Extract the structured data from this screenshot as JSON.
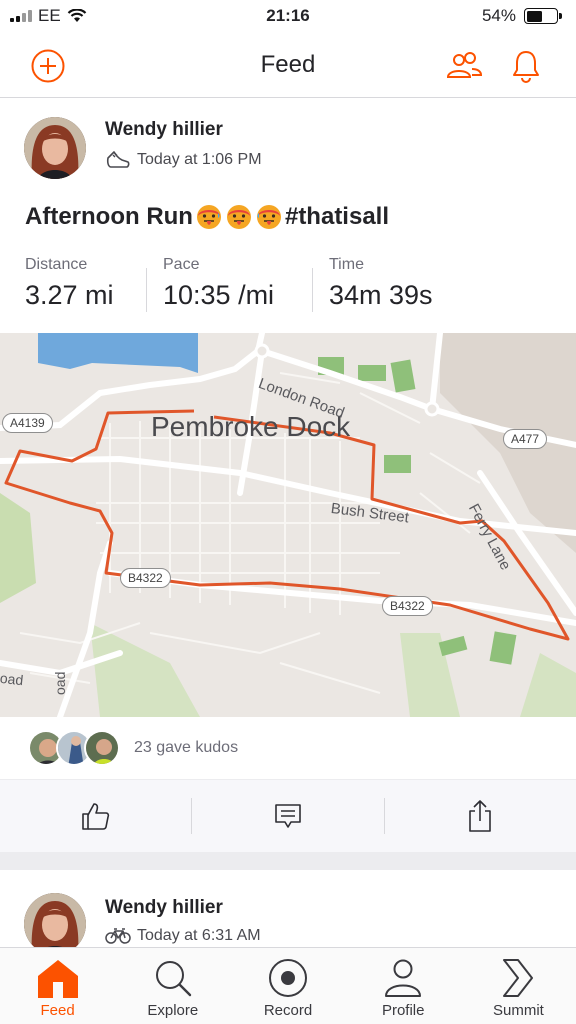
{
  "status_bar": {
    "carrier": "EE",
    "time": "21:16",
    "battery": "54%",
    "battery_level": 0.54
  },
  "header": {
    "title": "Feed",
    "accent_color": "#fc5200"
  },
  "activity": {
    "athlete": "Wendy hillier",
    "timestamp": "Today at 1:06 PM",
    "activity_icon": "shoe-icon",
    "title_text": "Afternoon Run",
    "title_emoji": [
      "hot-face-emoji",
      "hot-face-emoji",
      "hot-face-emoji"
    ],
    "title_hashtag": "#thatisall",
    "stats": [
      {
        "label": "Distance",
        "value": "3.27 mi"
      },
      {
        "label": "Pace",
        "value": "10:35 /mi"
      },
      {
        "label": "Time",
        "value": "34m 39s"
      }
    ],
    "map": {
      "town": "Pembroke Dock",
      "streets": [
        "London Road",
        "Bush Street",
        "Ferry Lane",
        "oad",
        "oad"
      ],
      "shields": [
        "A4139",
        "A477",
        "B4322",
        "B4322"
      ],
      "route_color": "#e0562a"
    },
    "kudos_text": "23 gave kudos"
  },
  "next_activity": {
    "athlete": "Wendy hillier",
    "timestamp": "Today at 6:31 AM",
    "activity_icon": "bike-icon"
  },
  "tabs": [
    {
      "label": "Feed",
      "icon": "home-icon",
      "active": true
    },
    {
      "label": "Explore",
      "icon": "search-icon",
      "active": false
    },
    {
      "label": "Record",
      "icon": "record-icon",
      "active": false
    },
    {
      "label": "Profile",
      "icon": "profile-icon",
      "active": false
    },
    {
      "label": "Summit",
      "icon": "summit-icon",
      "active": false
    }
  ]
}
